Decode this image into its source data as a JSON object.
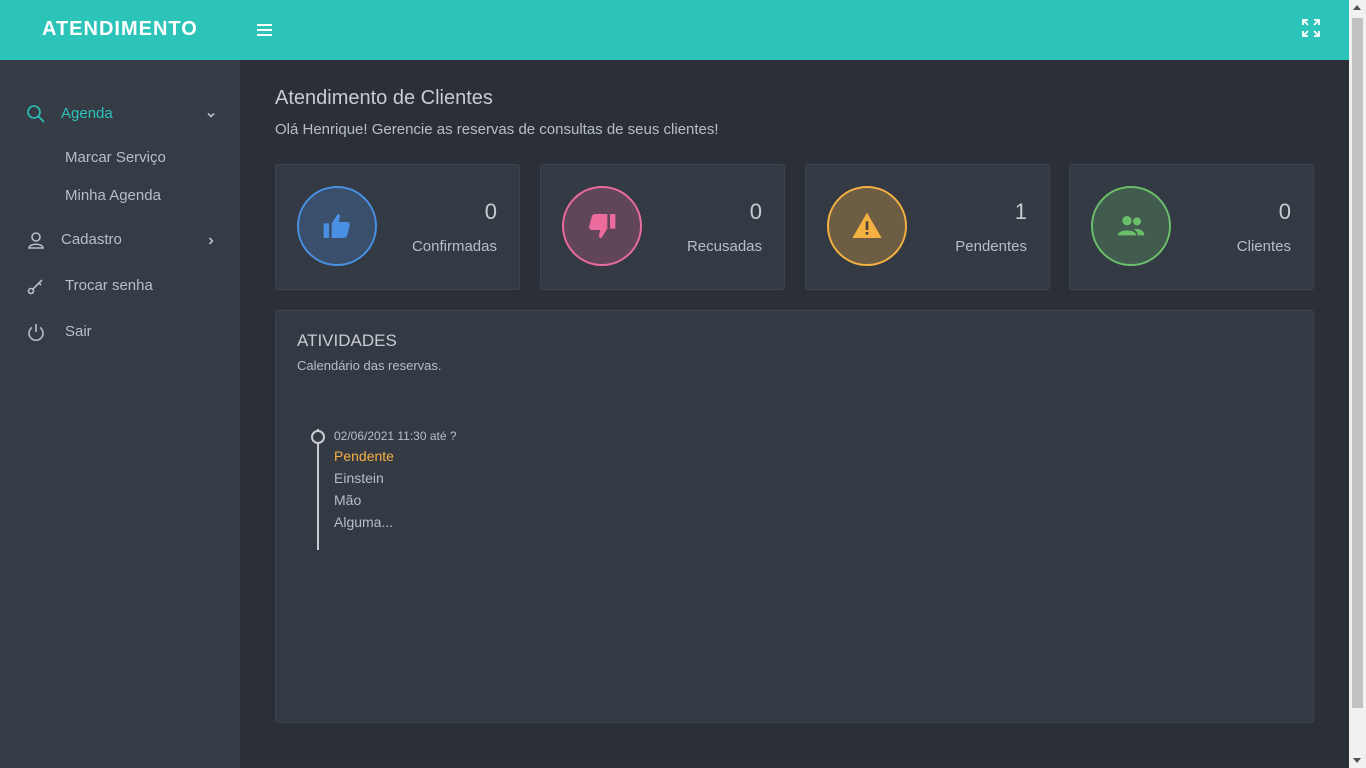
{
  "brand": "ATENDIMENTO",
  "sidebar": {
    "items": [
      {
        "label": "Agenda",
        "icon": "search-icon",
        "expanded": true,
        "active": true
      },
      {
        "label": "Cadastro",
        "icon": "user-icon"
      },
      {
        "label": "Trocar senha",
        "icon": "key-icon"
      },
      {
        "label": "Sair",
        "icon": "power-icon"
      }
    ],
    "agenda_sub": [
      "Marcar Serviço",
      "Minha Agenda"
    ]
  },
  "header": {
    "title": "Atendimento de Clientes",
    "subtitle": "Olá Henrique! Gerencie as reservas de consultas de seus clientes!"
  },
  "stats": [
    {
      "value": "0",
      "label": "Confirmadas",
      "icon": "thumbs-up-icon",
      "color": "#4a90e2"
    },
    {
      "value": "0",
      "label": "Recusadas",
      "icon": "thumbs-down-icon",
      "color": "#ec6b9d"
    },
    {
      "value": "1",
      "label": "Pendentes",
      "icon": "warning-icon",
      "color": "#f5b042"
    },
    {
      "value": "0",
      "label": "Clientes",
      "icon": "people-icon",
      "color": "#6bbf6a"
    }
  ],
  "activities": {
    "title": "ATIVIDADES",
    "subtitle": "Calendário das reservas.",
    "events": [
      {
        "date": "02/06/2021 11:30 até ?",
        "status": "Pendente",
        "client": "Einstein",
        "service": "Mão",
        "note": "Alguma..."
      }
    ]
  },
  "colors": {
    "accent": "#2cc4b8",
    "sidebar_bg": "#353c46",
    "content_bg": "#2b3038",
    "card_bg": "#333a44",
    "pending": "#f5b042"
  }
}
